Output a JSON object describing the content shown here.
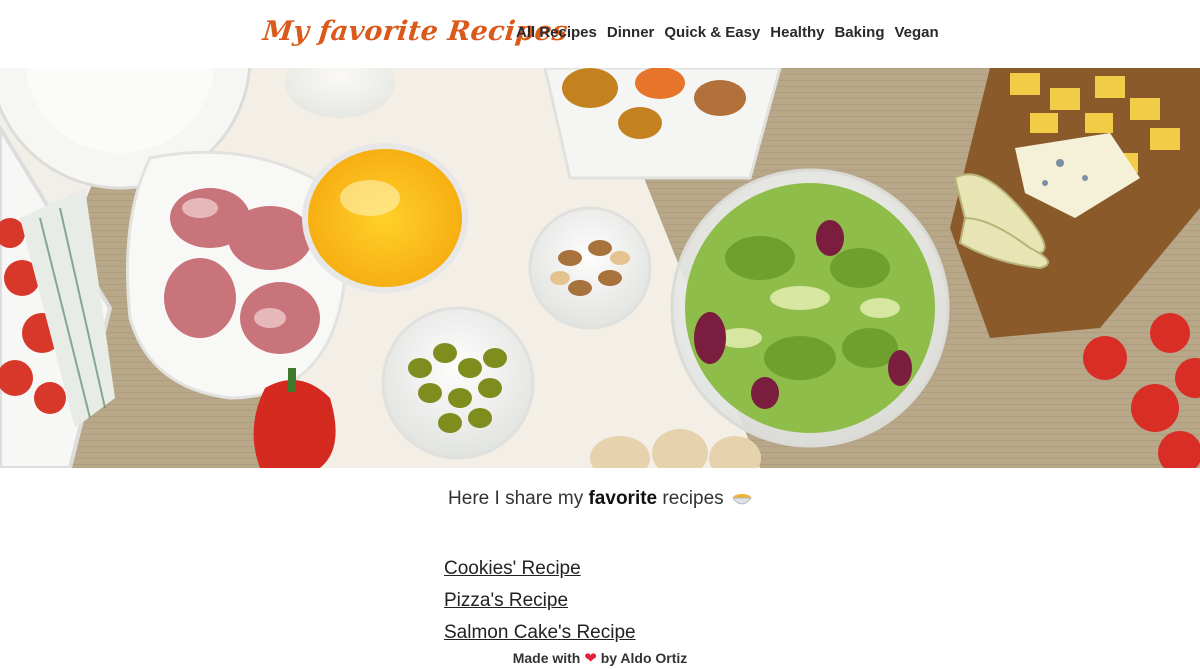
{
  "header": {
    "logo": "My favorite Recipes",
    "nav": [
      "All Recipes",
      "Dinner",
      "Quick & Easy",
      "Healthy",
      "Baking",
      "Vegan"
    ]
  },
  "hero": {
    "image": "food-spread-photo"
  },
  "intro": {
    "before": "Here I share my",
    "emphasis": "favorite",
    "after": "recipes",
    "icon": "bowl-icon"
  },
  "recipes": [
    "Cookies' Recipe",
    "Pizza's Recipe",
    "Salmon Cake's Recipe"
  ],
  "footer": {
    "before": "Made with",
    "heart": "❤",
    "after": "by Aldo Ortiz"
  },
  "colors": {
    "logo": "#d95a1b",
    "heart": "#e0223b"
  }
}
